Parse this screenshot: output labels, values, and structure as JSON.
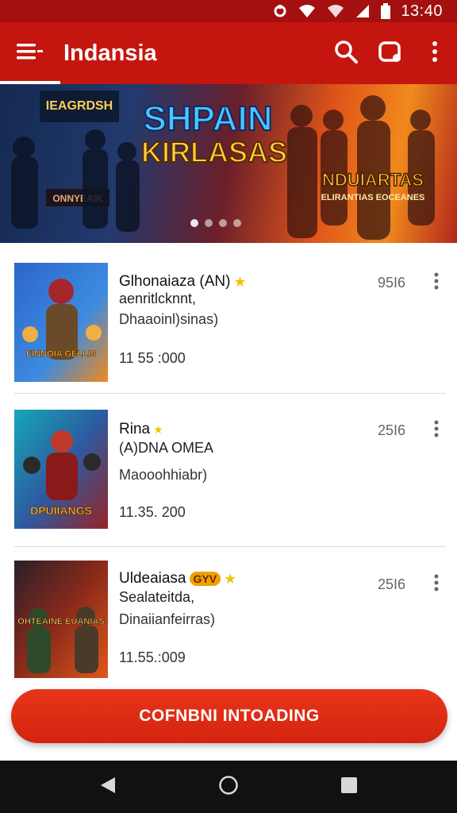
{
  "status_bar": {
    "time": "13:40"
  },
  "app_bar": {
    "title": "Indansia"
  },
  "hero": {
    "headline_line1": "SHPAIN",
    "headline_line2": "KIRLASAS",
    "sign_top": "IEAGRDSH",
    "sign_bottom": "ONNYEAIK",
    "logo_main": "NDUIARTAS",
    "logo_sub": "ELIRANTIAS EOCEANES",
    "page_count": 4,
    "active_page": 1
  },
  "items": [
    {
      "title": "Glhonaiaza (AN)",
      "has_star": true,
      "badge": "",
      "subtitle": "aenritlcknnt,",
      "meta": "Dhaaoinl)sinas)",
      "count": "11 55 :000",
      "size": "95I6",
      "thumb_art_text": "EINNOIA GELLIS",
      "colors": {
        "a": "#1f4fa8",
        "b": "#c0392b"
      }
    },
    {
      "title": "Rina",
      "has_star": false,
      "badge": "",
      "subtitle": "(A)DNA OMEA",
      "meta": "Maooohhiabr)",
      "count": "11.35. 200",
      "size": "25I6",
      "thumb_art_text": "DPUIIANGS",
      "colors": {
        "a": "#15a7b8",
        "b": "#9e1f1f"
      }
    },
    {
      "title": "Uldeaiasa",
      "has_star": true,
      "badge": "GYV",
      "subtitle": "Sealateitda,",
      "meta": "Dinaiianfeirras)",
      "count": "11.55.:009",
      "size": "25I6",
      "thumb_art_text": "OHTEAINE EUANIAS",
      "colors": {
        "a": "#3a2a2a",
        "b": "#e0581b"
      }
    }
  ],
  "cta": {
    "label": "COFNBNI INTOADING"
  },
  "colors": {
    "primary": "#c4160f",
    "status_bar": "#a40f0f",
    "accent_star": "#f2c200",
    "nav_bar": "#111111"
  }
}
